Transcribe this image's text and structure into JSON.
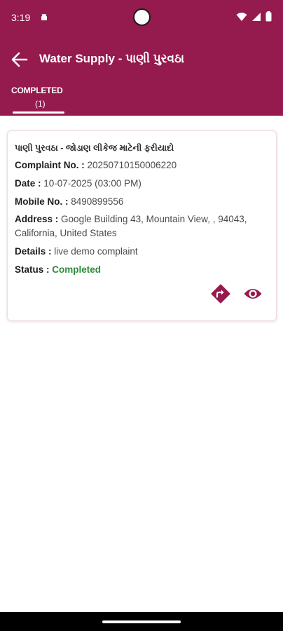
{
  "status_bar": {
    "time": "3:19"
  },
  "app_bar": {
    "title": "Water Supply - પાણી પુરવઠા"
  },
  "tabs": [
    {
      "label": "COMPLETED",
      "count": "(1)"
    }
  ],
  "complaint": {
    "title": "પાણી પુરવઠા - જોડાણ લીકેજ માટેની ફરીયાદો",
    "complaint_no_label": "Complaint No. :",
    "complaint_no": "20250710150006220",
    "date_label": "Date :",
    "date": "10-07-2025 (03:00 PM)",
    "mobile_label": "Mobile No. :",
    "mobile": "8490899556",
    "address_label": "Address :",
    "address": "Google Building 43, Mountain View, , 94043, California, United States",
    "details_label": "Details :",
    "details": "live demo complaint",
    "status_label": "Status :",
    "status": "Completed"
  },
  "colors": {
    "primary": "#951a4e",
    "status_completed": "#2e8b3a"
  },
  "icons": [
    "back-arrow-icon",
    "share-icon",
    "eye-icon",
    "wifi-icon",
    "signal-icon",
    "battery-icon"
  ]
}
